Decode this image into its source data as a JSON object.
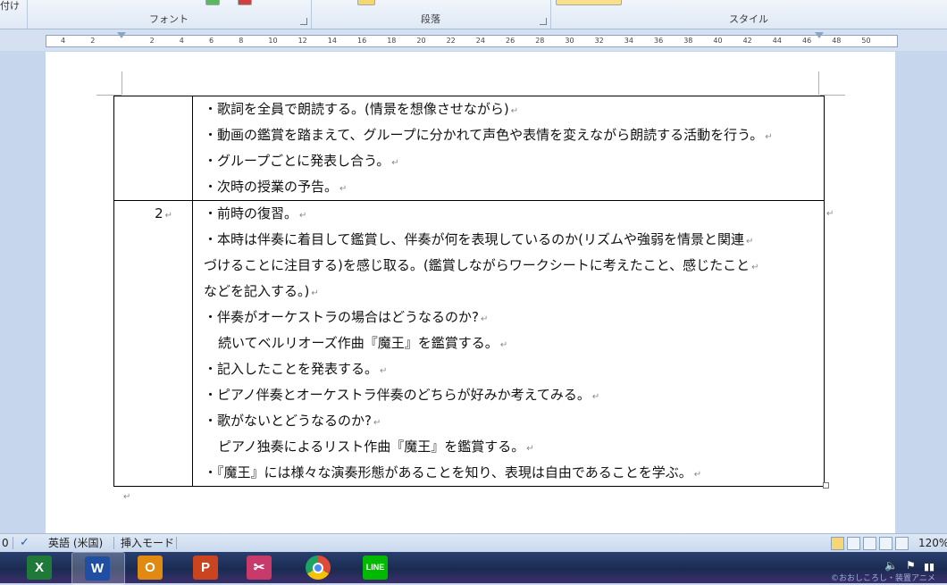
{
  "ribbon": {
    "left_cut_label": "付け",
    "groups": [
      "フォント",
      "段落",
      "スタイル"
    ]
  },
  "ruler": {
    "ticks": [
      "4",
      "2",
      "",
      "2",
      "4",
      "6",
      "8",
      "10",
      "12",
      "14",
      "16",
      "18",
      "20",
      "22",
      "24",
      "26",
      "28",
      "30",
      "32",
      "34",
      "36",
      "38",
      "40",
      "42",
      "44",
      "46",
      "48",
      "50"
    ]
  },
  "document": {
    "rows": [
      {
        "number": "",
        "lines": [
          {
            "text": "・歌詞を全員で朗読する。(情景を想像させながら)",
            "indent": false
          },
          {
            "text": "・動画の鑑賞を踏まえて、グループに分かれて声色や表情を変えながら朗読する活動を行う。",
            "indent": false
          },
          {
            "text": "・グループごとに発表し合う。",
            "indent": false
          },
          {
            "text": "・次時の授業の予告。",
            "indent": false
          }
        ]
      },
      {
        "number": "2",
        "lines": [
          {
            "text": "・前時の復習。",
            "indent": false
          },
          {
            "text": "・本時は伴奏に着目して鑑賞し、伴奏が何を表現しているのか(リズムや強弱を情景と関連",
            "indent": false
          },
          {
            "text": "づけることに注目する)を感じ取る。(鑑賞しながらワークシートに考えたこと、感じたこと",
            "indent": false
          },
          {
            "text": "などを記入する。)",
            "indent": false
          },
          {
            "text": "・伴奏がオーケストラの場合はどうなるのか?",
            "indent": false
          },
          {
            "text": "続いてベルリオーズ作曲『魔王』を鑑賞する。",
            "indent": true
          },
          {
            "text": "・記入したことを発表する。",
            "indent": false
          },
          {
            "text": "・ピアノ伴奏とオーケストラ伴奏のどちらが好みか考えてみる。",
            "indent": false
          },
          {
            "text": "・歌がないとどうなるのか?",
            "indent": false
          },
          {
            "text": "ピアノ独奏によるリスト作曲『魔王』を鑑賞する。",
            "indent": true
          },
          {
            "text": "・『魔王』には様々な演奏形態があることを知り、表現は自由であることを学ぶ。",
            "indent": false
          }
        ]
      }
    ],
    "paragraph_mark": "↵"
  },
  "statusbar": {
    "page_fragment": "0",
    "language": "英語 (米国)",
    "mode": "挿入モード",
    "zoom": "120%"
  },
  "taskbar": {
    "apps": [
      {
        "name": "excel",
        "glyph": "X",
        "color": "#1f7a3a"
      },
      {
        "name": "word",
        "glyph": "W",
        "color": "#1f4ea3"
      },
      {
        "name": "outlook",
        "glyph": "O",
        "color": "#e08a12"
      },
      {
        "name": "powerpoint",
        "glyph": "P",
        "color": "#c9441f"
      },
      {
        "name": "snipping-tool",
        "glyph": "✂",
        "color": "#c83a6a"
      },
      {
        "name": "chrome",
        "glyph": "",
        "color": "#dd4b39"
      },
      {
        "name": "line",
        "glyph": "LINE",
        "color": "#00b900"
      }
    ],
    "tray_text": "©おおしころし・装置アニメ"
  }
}
